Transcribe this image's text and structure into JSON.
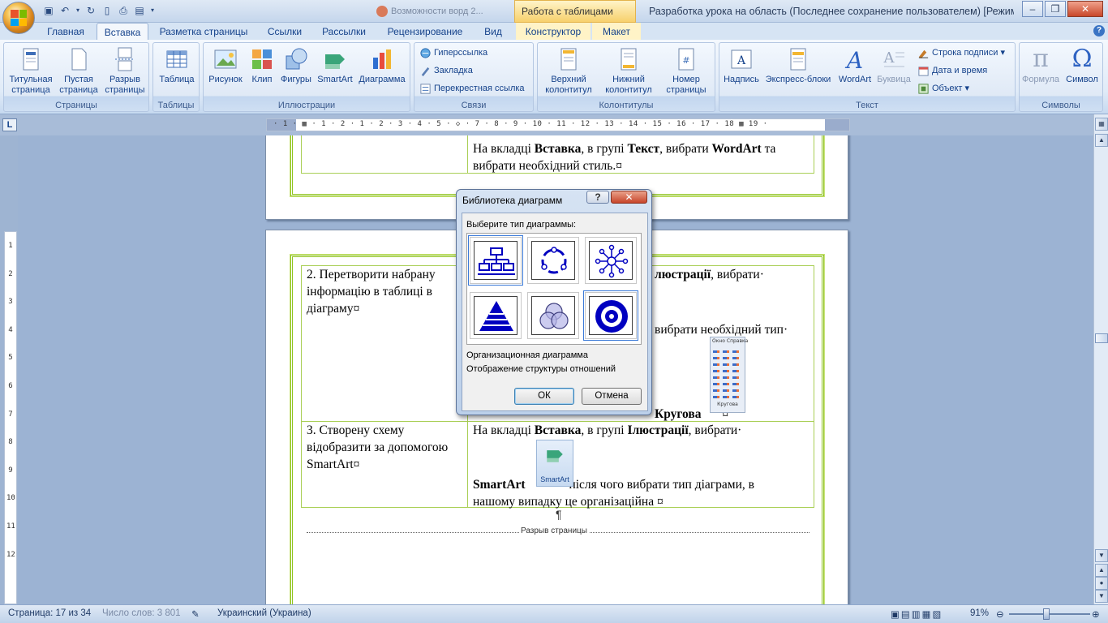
{
  "titlebar": {
    "window_title": "Разработка урока на область (Последнее сохранение пользователем) [Режим ...",
    "context_title": "Работа с таблицами",
    "doc_tab": "Возможности ворд 2..."
  },
  "tabs": [
    "Главная",
    "Вставка",
    "Разметка страницы",
    "Ссылки",
    "Рассылки",
    "Рецензирование",
    "Вид",
    "Конструктор",
    "Макет"
  ],
  "ribbon": {
    "pages": {
      "label": "Страницы",
      "title_page": "Титульная страница",
      "blank_page": "Пустая страница",
      "page_break": "Разрыв страницы"
    },
    "tables": {
      "label": "Таблицы",
      "table": "Таблица"
    },
    "illustrations": {
      "label": "Иллюстрации",
      "picture": "Рисунок",
      "clip": "Клип",
      "shapes": "Фигуры",
      "smartart": "SmartArt",
      "chart": "Диаграмма"
    },
    "links": {
      "label": "Связи",
      "hyperlink": "Гиперссылка",
      "bookmark": "Закладка",
      "crossref": "Перекрестная ссылка"
    },
    "headers": {
      "label": "Колонтитулы",
      "header": "Верхний колонтитул",
      "footer": "Нижний колонтитул",
      "page_number": "Номер страницы"
    },
    "text": {
      "label": "Текст",
      "textbox": "Надпись",
      "quickparts": "Экспресс-блоки",
      "wordart": "WordArt",
      "dropcap": "Буквица",
      "signature": "Строка подписи",
      "datetime": "Дата и время",
      "object": "Объект"
    },
    "symbols": {
      "label": "Символы",
      "equation": "Формула",
      "symbol": "Символ"
    }
  },
  "ruler": {
    "h_ticks": "· 1 · ▦ · 1 · 2 · 1 · 2 · 3 · 4 · 5 · ◇ · 7 · 8 · 9 · 10 · 11 · 12 · 13 · 14 · 15 · 16 · 17 · 18 ▦ 19 ·",
    "corner": "L"
  },
  "document": {
    "top_cell": {
      "t1": "На вкладці ",
      "b1": "Вставка",
      "t2": ", в групі ",
      "b2": "Текст",
      "t3": ", вибрати ",
      "b3": "WordArt",
      "t4": " та",
      "line2": "вибрати необхідний стиль.¤"
    },
    "row2_left": "2. Перетворити набрану інформацію в таблиці в діаграму¤",
    "row2_right": {
      "a1": "люстрації",
      "a2": ", вибрати·",
      "b": "вибрати необхідний тип·",
      "c1": "Кругова",
      "c2": " ¤"
    },
    "row3_left": "3. Створену схему відобразити за допомогою SmartArt¤",
    "row3_right": {
      "t1": "На вкладці ",
      "b1": "Вставка",
      "t2": ", в групі ",
      "b2": "Ілюстрації",
      "t3": ", вибрати·",
      "b3": "SmartArt",
      "t4": " після чого вибрати тип діаграми, в",
      "line3": "нашому випадку це організаційна ¤"
    },
    "smartart_icon_label": "SmartArt",
    "chart_menu_labels": {
      "m1": "Окно",
      "m2": "Справка",
      "caption": "Кругова"
    },
    "pilcrow": "¶",
    "page_break": "Разрыв страницы"
  },
  "dialog": {
    "title": "Библиотека диаграмм",
    "help": "?",
    "close": "✕",
    "prompt": "Выберите тип диаграммы:",
    "selected_name": "Организационная диаграмма",
    "selected_desc": "Отображение структуры отношений",
    "ok": "ОК",
    "cancel": "Отмена",
    "tiles": [
      "org-chart",
      "cycle",
      "radial",
      "pyramid",
      "venn",
      "target"
    ]
  },
  "status": {
    "page": "Страница: 17 из 34",
    "words": "Число слов: 3 801",
    "lang": "Украинский (Украина)",
    "zoom": "91%"
  },
  "colors": {
    "accent": "#15428b",
    "frame_green": "#8fc31f",
    "diagram_blue": "#0000c0"
  }
}
